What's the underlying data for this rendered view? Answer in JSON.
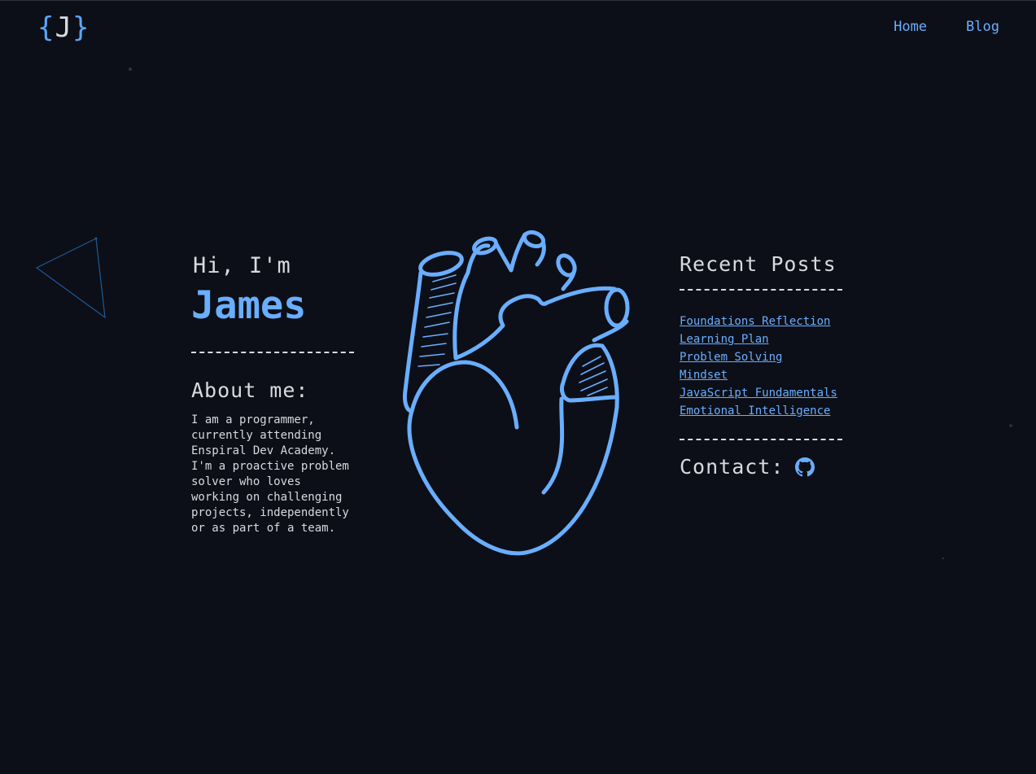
{
  "header": {
    "logo": {
      "open": "{",
      "letter": "J",
      "close": "}"
    },
    "nav": [
      {
        "label": "Home"
      },
      {
        "label": "Blog"
      }
    ]
  },
  "intro": {
    "greeting": "Hi, I'm",
    "name": "James"
  },
  "about": {
    "title": "About me:",
    "text": "I am a programmer, currently attending Enspiral Dev Academy. I'm a proactive problem solver who loves working on challenging projects, independently or as part of a team."
  },
  "posts": {
    "title": "Recent Posts",
    "items": [
      {
        "label": "Foundations Reflection"
      },
      {
        "label": "Learning Plan"
      },
      {
        "label": "Problem Solving"
      },
      {
        "label": "Mindset"
      },
      {
        "label": "JavaScript Fundamentals"
      },
      {
        "label": "Emotional Intelligence"
      }
    ]
  },
  "contact": {
    "title": "Contact:",
    "icon": "github-icon"
  },
  "colors": {
    "background": "#0c0f17",
    "accent": "#6aaeff",
    "text": "#d7dae0"
  }
}
